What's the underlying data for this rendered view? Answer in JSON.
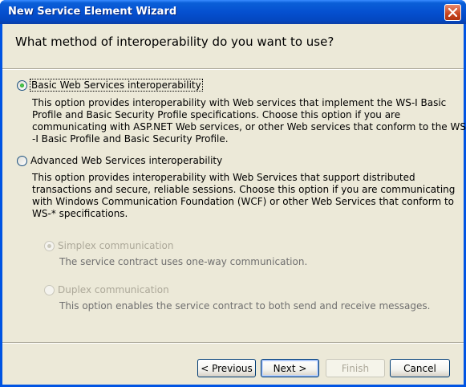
{
  "window": {
    "title": "New Service Element Wizard"
  },
  "heading": "What method of interoperability do you want to use?",
  "options": {
    "basic": {
      "label": "Basic Web Services interoperability",
      "description": "This option provides interoperability with Web services that implement the WS-I Basic\nProfile and Basic Security Profile specifications. Choose this option if you are\ncommunicating with ASP.NET Web services, or other Web services that conform to the WS\n-I Basic Profile and Basic Security Profile.",
      "selected": true
    },
    "advanced": {
      "label": "Advanced Web Services interoperability",
      "description": "This option provides interoperability with Web Services that support distributed\ntransactions and secure, reliable sessions. Choose this option if you are communicating\nwith Windows Communication Foundation (WCF) or other Web Services that conform to\nWS-* specifications.",
      "selected": false
    },
    "simplex": {
      "label": "Simplex communication",
      "description": "The service contract uses one-way communication.",
      "selected": true,
      "enabled": false
    },
    "duplex": {
      "label": "Duplex communication",
      "description": "This option enables the service contract to both send and receive messages.",
      "selected": false,
      "enabled": false
    }
  },
  "buttons": {
    "previous": "< Previous",
    "next": "Next >",
    "finish": "Finish",
    "cancel": "Cancel"
  },
  "icons": {
    "close": "close-icon"
  },
  "colors": {
    "titlebar": "#0054e3",
    "face": "#ece9d8",
    "disabled_text": "#aca899"
  }
}
